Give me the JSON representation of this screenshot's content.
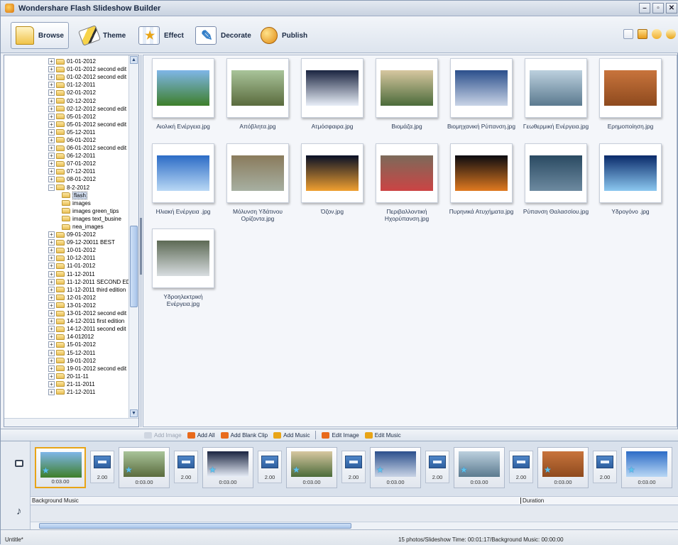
{
  "window": {
    "title": "Wondershare Flash Slideshow Builder",
    "controls": [
      "–",
      "▫",
      "✕"
    ]
  },
  "toolbar": {
    "tabs": [
      {
        "label": "Browse",
        "icon": "folder-open-icon"
      },
      {
        "label": "Theme",
        "icon": "theme-icon"
      },
      {
        "label": "Effect",
        "icon": "effect-icon"
      },
      {
        "label": "Decorate",
        "icon": "decorate-icon"
      },
      {
        "label": "Publish",
        "icon": "publish-icon"
      }
    ],
    "active_tab": "Browse"
  },
  "tree": {
    "items": [
      {
        "label": "01-01-2012",
        "level": 0
      },
      {
        "label": "01-01-2012 second edit",
        "level": 0
      },
      {
        "label": "01-02-2012 second edit",
        "level": 0
      },
      {
        "label": "01-12-2011",
        "level": 0
      },
      {
        "label": "02-01-2012",
        "level": 0
      },
      {
        "label": "02-12-2012",
        "level": 0
      },
      {
        "label": "02-12-2012 second edit",
        "level": 0
      },
      {
        "label": "05-01-2012",
        "level": 0
      },
      {
        "label": "05-01-2012 second edit",
        "level": 0
      },
      {
        "label": "05-12-2011",
        "level": 0
      },
      {
        "label": "06-01-2012",
        "level": 0
      },
      {
        "label": "06-01-2012 second edit",
        "level": 0
      },
      {
        "label": "06-12-2011",
        "level": 0
      },
      {
        "label": "07-01-2012",
        "level": 0
      },
      {
        "label": "07-12-2011",
        "level": 0
      },
      {
        "label": "08-01-2012",
        "level": 0
      },
      {
        "label": "8-2-2012",
        "level": 0,
        "expanded": true
      },
      {
        "label": "flash",
        "level": 1,
        "selected": true
      },
      {
        "label": "images",
        "level": 1
      },
      {
        "label": "images green_tips",
        "level": 1
      },
      {
        "label": "images text_busine",
        "level": 1
      },
      {
        "label": "nea_images",
        "level": 1
      },
      {
        "label": "09-01-2012",
        "level": 0
      },
      {
        "label": "09-12-20011 BEST",
        "level": 0
      },
      {
        "label": "10-01-2012",
        "level": 0
      },
      {
        "label": "10-12-2011",
        "level": 0
      },
      {
        "label": "11-01-2012",
        "level": 0
      },
      {
        "label": "11-12-2011",
        "level": 0
      },
      {
        "label": "11-12-2011 SECOND ED",
        "level": 0
      },
      {
        "label": "11-12-2011 third edition",
        "level": 0
      },
      {
        "label": "12-01-2012",
        "level": 0
      },
      {
        "label": "13-01-2012",
        "level": 0
      },
      {
        "label": "13-01-2012 second edit",
        "level": 0
      },
      {
        "label": "14-12-2011 first edition",
        "level": 0
      },
      {
        "label": "14-12-2011 second edit",
        "level": 0
      },
      {
        "label": "14-012012",
        "level": 0
      },
      {
        "label": "15-01-2012",
        "level": 0
      },
      {
        "label": "15-12-2011",
        "level": 0
      },
      {
        "label": "19-01-2012",
        "level": 0
      },
      {
        "label": "19-01-2012 second edit",
        "level": 0
      },
      {
        "label": "20-11-11",
        "level": 0
      },
      {
        "label": "21-11-2011",
        "level": 0
      },
      {
        "label": "21-12-2011",
        "level": 0
      }
    ]
  },
  "gallery": {
    "items": [
      {
        "name": "Αιολική Ενέργεια.jpg",
        "colors": [
          "#7fb6e8",
          "#3e7f2a"
        ]
      },
      {
        "name": "Απόβλητα.jpg",
        "colors": [
          "#a9c49a",
          "#5a6b3d"
        ]
      },
      {
        "name": "Ατμόσφαιρα.jpg",
        "colors": [
          "#1a2440",
          "#e8eef8"
        ]
      },
      {
        "name": "Βιομάζα.jpg",
        "colors": [
          "#d7c7a0",
          "#4b6b3a"
        ]
      },
      {
        "name": "Βιομηχανική Ρύπανση.jpg",
        "colors": [
          "#2b4f8c",
          "#c9d4e6"
        ]
      },
      {
        "name": "Γεωθερμική Ενέργεια.jpg",
        "colors": [
          "#bcd0de",
          "#5b7a8f"
        ]
      },
      {
        "name": "Ερημοποίηση.jpg",
        "colors": [
          "#c8743c",
          "#8e4a1e"
        ]
      },
      {
        "name": "Ηλιακή Ενέργεια .jpg",
        "colors": [
          "#2c6cc6",
          "#b9d8f5"
        ]
      },
      {
        "name": "Μόλυνση Υδάτινου Ορίζοντα.jpg",
        "colors": [
          "#8a7b5c",
          "#a7b0a2"
        ]
      },
      {
        "name": "Όζον.jpg",
        "colors": [
          "#081026",
          "#f0a030"
        ]
      },
      {
        "name": "Περιβαλλοντική Ηχορύπανση.jpg",
        "colors": [
          "#7c6a5a",
          "#c44"
        ]
      },
      {
        "name": "Πυρηνικά Ατυχήματα.jpg",
        "colors": [
          "#0b0b10",
          "#e07a20"
        ]
      },
      {
        "name": "Ρύπανση Θαλασσίου.jpg",
        "colors": [
          "#2a4a62",
          "#6d8aa0"
        ]
      },
      {
        "name": "Υδρογόνο .jpg",
        "colors": [
          "#0a2a6a",
          "#8cc8f0"
        ]
      },
      {
        "name": "Υδροηλεκτρική Ενέργεια.jpg",
        "colors": [
          "#5d6a55",
          "#d8dde0"
        ]
      }
    ]
  },
  "actions": {
    "add_image": "Add Image",
    "add_all": "Add All",
    "add_blank_clip": "Add Blank Clip",
    "add_music": "Add Music",
    "edit_image": "Edit Image",
    "edit_music": "Edit Music"
  },
  "storyboard": {
    "clips": [
      {
        "duration": "0:03.00",
        "colors": [
          "#7fb6e8",
          "#3e7f2a"
        ]
      },
      {
        "duration": "0:03.00",
        "colors": [
          "#a9c49a",
          "#5a6b3d"
        ]
      },
      {
        "duration": "0:03.00",
        "colors": [
          "#1a2440",
          "#e8eef8"
        ]
      },
      {
        "duration": "0:03.00",
        "colors": [
          "#d7c7a0",
          "#4b6b3a"
        ]
      },
      {
        "duration": "0:03.00",
        "colors": [
          "#2b4f8c",
          "#c9d4e6"
        ]
      },
      {
        "duration": "0:03.00",
        "colors": [
          "#bcd0de",
          "#5b7a8f"
        ]
      },
      {
        "duration": "0:03.00",
        "colors": [
          "#c8743c",
          "#8e4a1e"
        ]
      },
      {
        "duration": "0:03.00",
        "colors": [
          "#2c6cc6",
          "#b9d8f5"
        ]
      }
    ],
    "transitions": [
      "2.00",
      "2.00",
      "2.00",
      "2.00",
      "2.00",
      "2.00",
      "2.00"
    ]
  },
  "music": {
    "background_label": "Background Music",
    "duration_label": "Duration"
  },
  "status": {
    "left": "Untitle*",
    "right": "15 photos/Slideshow Time: 00:01:17/Background Music: 00:00:00"
  },
  "colors": {
    "accent": "#e8a416",
    "selection": "#d3dff2",
    "border": "#8fa0bb"
  }
}
